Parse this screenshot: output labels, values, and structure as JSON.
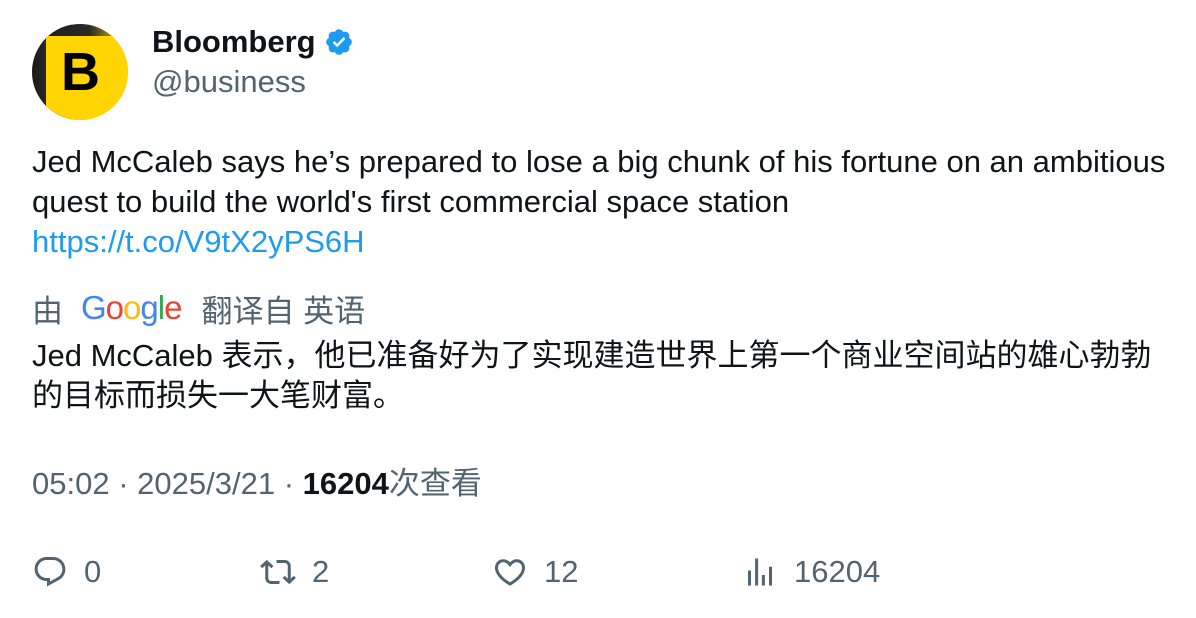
{
  "author": {
    "display_name": "Bloomberg",
    "handle": "@business",
    "avatar_letter": "B",
    "verified": true,
    "avatar_color": "#ffd400"
  },
  "tweet": {
    "text": "Jed McCaleb says he’s prepared to lose a big chunk of his fortune on an ambitious quest to build the world's first commercial space station",
    "link": "https://t.co/V9tX2yPS6H"
  },
  "translation": {
    "prefix": "由",
    "provider_logo": "Google",
    "suffix": "翻译自 英语",
    "text": "Jed McCaleb 表示，他已准备好为了实现建造世界上第一个商业空间站的雄心勃勃的目标而损失一大笔财富。"
  },
  "meta": {
    "time": "05:02",
    "separator": "·",
    "date": "2025/3/21",
    "views_count": "16204",
    "views_label": "次查看"
  },
  "actions": {
    "replies": "0",
    "retweets": "2",
    "likes": "12",
    "views": "16204"
  },
  "colors": {
    "link": "#1d9bf0",
    "secondary_text": "#536471",
    "verified_badge": "#1d9bf0"
  }
}
